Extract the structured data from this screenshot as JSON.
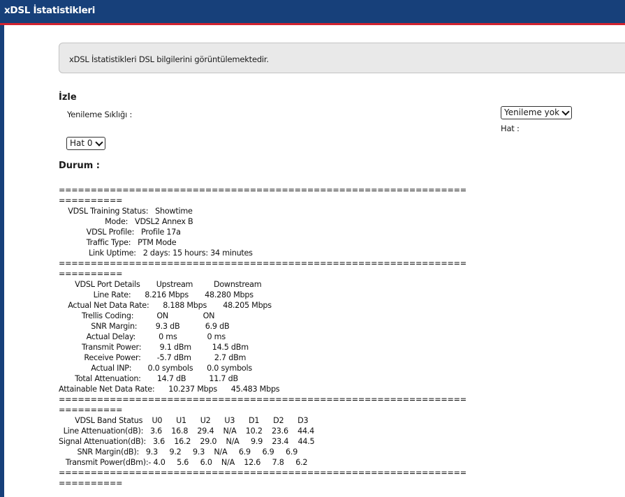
{
  "header": {
    "title": "xDSL İstatistikleri"
  },
  "info": {
    "text": "xDSL İstatistikleri DSL bilgilerini görüntülemektedir."
  },
  "monitor": {
    "title": "İzle",
    "refresh_label": "Yenileme Sıklığı :",
    "refresh_value": "Yenileme yok",
    "line_label": "Hat :",
    "line_value": "Hat 0"
  },
  "status": {
    "title": "Durum :",
    "text": "================================================================\n==========\n    VDSL Training Status:   Showtime\n                    Mode:   VDSL2 Annex B\n            VDSL Profile:   Profile 17a\n            Traffic Type:   PTM Mode\n             Link Uptime:   2 days: 15 hours: 34 minutes\n================================================================\n==========\n       VDSL Port Details       Upstream         Downstream\n               Line Rate:      8.216 Mbps       48.280 Mbps\n    Actual Net Data Rate:      8.188 Mbps       48.205 Mbps\n          Trellis Coding:          ON               ON\n              SNR Margin:        9.3 dB           6.9 dB\n            Actual Delay:          0 ms             0 ms\n          Transmit Power:        9.1 dBm         14.5 dBm\n           Receive Power:       -5.7 dBm          2.7 dBm\n              Actual INP:       0.0 symbols      0.0 symbols\n       Total Attenuation:       14.7 dB          11.7 dB\nAttainable Net Data Rate:      10.237 Mbps      45.483 Mbps\n================================================================\n==========\n       VDSL Band Status    U0      U1      U2      U3      D1      D2      D3\n  Line Attenuation(dB):   3.6    16.8    29.4    N/A    10.2    23.6    44.4\nSignal Attenuation(dB):   3.6    16.2    29.0    N/A     9.9    23.4    44.5\n        SNR Margin(dB):   9.3     9.2     9.3    N/A     6.9     6.9     6.9\n   Transmit Power(dBm):- 4.0     5.6     6.0    N/A    12.6     7.8     6.2\n================================================================\n=========="
  },
  "colors": {
    "header_bg": "#17407a",
    "accent_red": "#d2232f",
    "info_bg": "#e9e9e9"
  }
}
